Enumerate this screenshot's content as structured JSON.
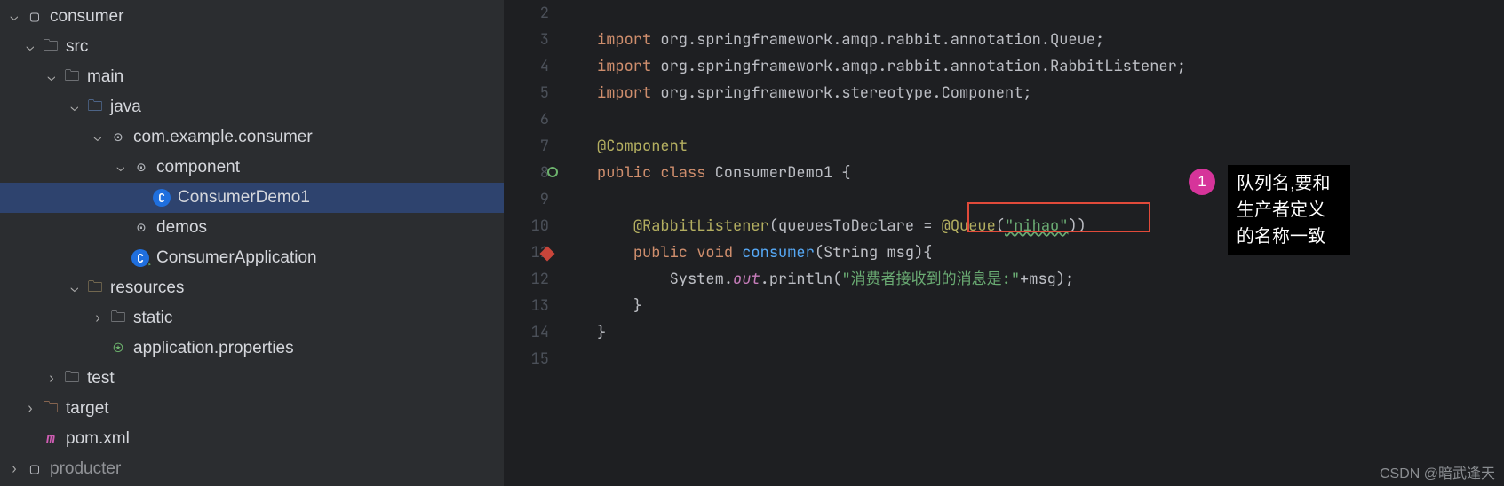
{
  "tree": {
    "consumer": "consumer",
    "src": "src",
    "main": "main",
    "java": "java",
    "pkg": "com.example.consumer",
    "component": "component",
    "consumerDemo1": "ConsumerDemo1",
    "demos": "demos",
    "consumerApplication": "ConsumerApplication",
    "resources": "resources",
    "static": "static",
    "appProps": "application.properties",
    "test": "test",
    "target": "target",
    "pom": "pom.xml",
    "producter": "producter"
  },
  "gutter": [
    "2",
    "3",
    "4",
    "5",
    "6",
    "7",
    "8",
    "9",
    "10",
    "11",
    "12",
    "13",
    "14",
    "15"
  ],
  "code": {
    "import": "import",
    "p1": "org.springframework.amqp.rabbit.annotation.Queue",
    "p2": "org.springframework.amqp.rabbit.annotation.RabbitListener",
    "p3": "org.springframework.stereotype.Component",
    "annComponent": "@Component",
    "public": "public",
    "class": "class",
    "clsName": "ConsumerDemo1",
    "ob": "{",
    "annRabbit": "@RabbitListener",
    "paramName": "queuesToDeclare",
    "annQueue": "@Queue",
    "qstr": "\"nihao\"",
    "void": "void",
    "mConsumer": "consumer",
    "argType": "String",
    "argName": "msg",
    "sys": "System",
    "out": "out",
    "println": "println",
    "msgStr": "\"消费者接收到的消息是:\"",
    "plusMsg": "+msg",
    "cb1": "}",
    "cb2": "}"
  },
  "callout": {
    "num": "1",
    "text": "队列名,要和生产者定义的名称一致"
  },
  "watermark": "CSDN @暗武逢天"
}
